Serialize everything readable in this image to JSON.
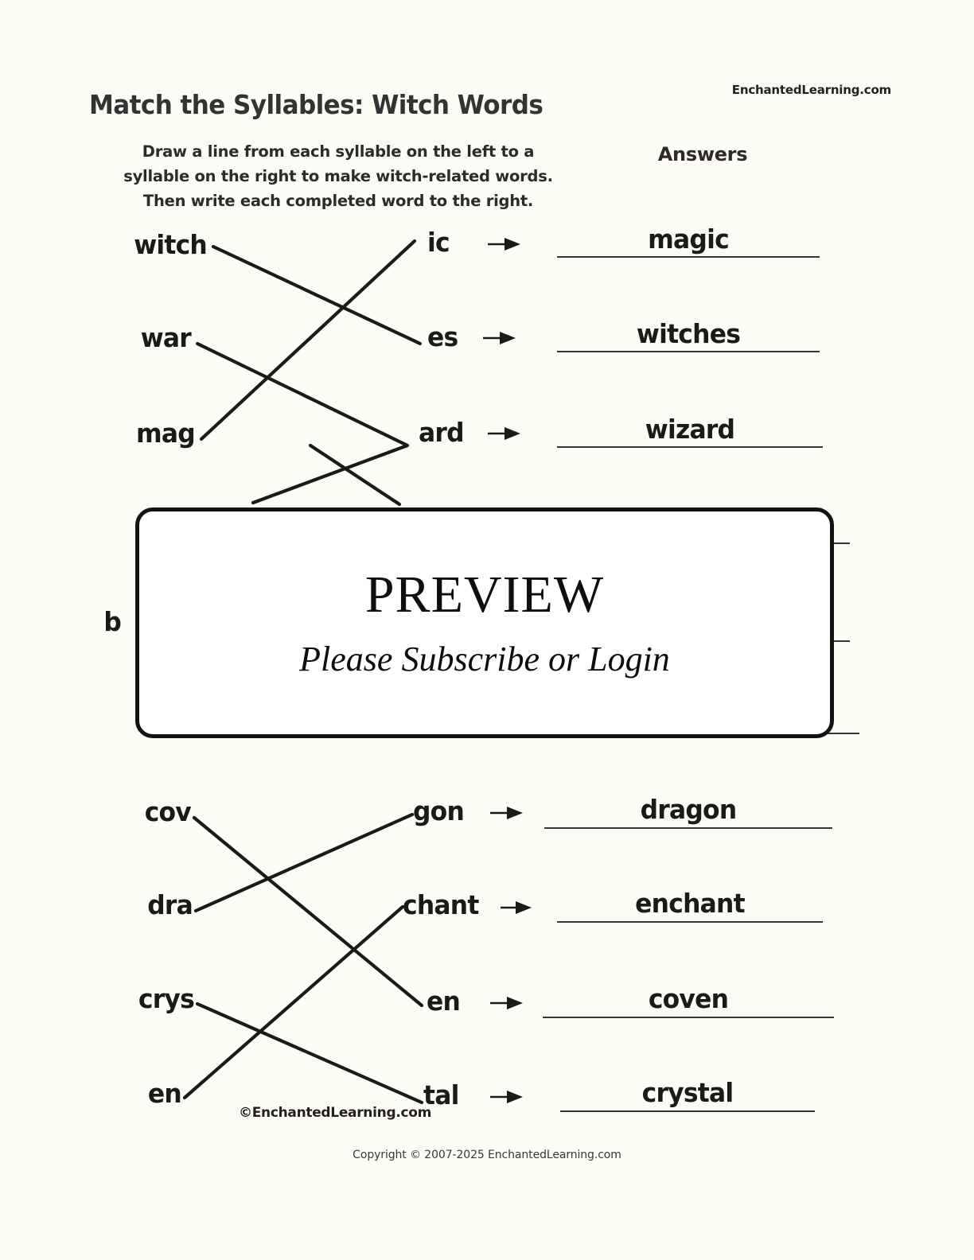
{
  "header": {
    "brand": "EnchantedLearning.com",
    "title": "Match the Syllables: Witch Words",
    "instructions_line1": "Draw a line from each syllable on the left to a",
    "instructions_line2": "syllable on the right to make witch-related words.",
    "instructions_line3": "Then write each completed word to the right.",
    "answers_label": "Answers"
  },
  "groups": [
    {
      "left_syllables": [
        "witch",
        "war",
        "mag"
      ],
      "right_syllables": [
        "ic",
        "es",
        "ard"
      ],
      "answers": [
        "magic",
        "witches",
        "wizard"
      ],
      "matches": [
        {
          "left": "witch",
          "right": "es"
        },
        {
          "left": "war",
          "right": "ard"
        },
        {
          "left": "mag",
          "right": "ic"
        }
      ]
    },
    {
      "left_syllables": [
        "cov",
        "dra",
        "crys",
        "en"
      ],
      "right_syllables": [
        "gon",
        "chant",
        "en",
        "tal"
      ],
      "answers": [
        "dragon",
        "enchant",
        "coven",
        "crystal"
      ],
      "matches": [
        {
          "left": "cov",
          "right": "en"
        },
        {
          "left": "dra",
          "right": "gon"
        },
        {
          "left": "crys",
          "right": "tal"
        },
        {
          "left": "en",
          "right": "chant"
        }
      ]
    }
  ],
  "obscured": {
    "left_syllable_partial": "b"
  },
  "preview_overlay": {
    "title": "PREVIEW",
    "subtitle": "Please Subscribe or Login"
  },
  "footer": {
    "inline_copyright": "©EnchantedLearning.com",
    "bottom_copyright": "Copyright © 2007-2025 EnchantedLearning.com"
  },
  "colors": {
    "page_background": "#fcfbf4",
    "ink": "#1c1a19",
    "title": "#333333",
    "overlay_background": "#ffffff",
    "overlay_border": "#15120f"
  }
}
